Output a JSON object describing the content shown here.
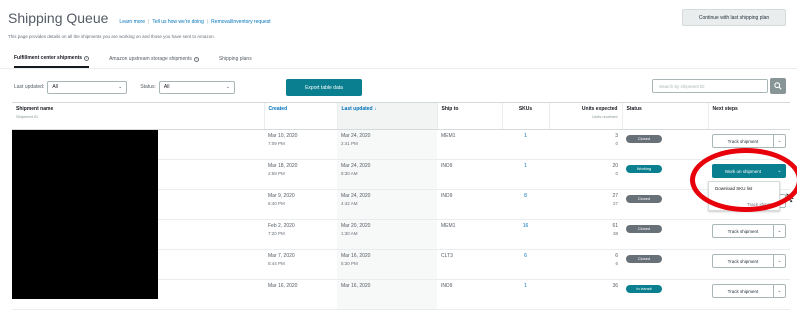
{
  "header": {
    "title": "Shipping Queue",
    "links": [
      "Learn more",
      "Tell us how we're doing",
      "Removal/inventory request"
    ],
    "continue_button": "Continue with last shipping plan"
  },
  "description": "This page provides details on all the shipments you are working on and those you have sent to Amazon.",
  "tabs": [
    "Fulfillment center shipments",
    "Amazon upstream storage shipments",
    "Shipping plans"
  ],
  "filters": {
    "last_updated_label": "Last updated:",
    "last_updated_value": "All",
    "status_label": "Status:",
    "status_value": "All",
    "export_button": "Export table data",
    "search_placeholder": "Search by shipment ID"
  },
  "table": {
    "headers": {
      "name": "Shipment name",
      "name_sub": "Shipment ID",
      "created": "Created",
      "last_updated": "Last updated",
      "ship_to": "Ship to",
      "skus": "SKUs",
      "units": "Units expected",
      "units_sub": "Units received",
      "status": "Status",
      "next": "Next steps"
    },
    "rows": [
      {
        "created_date": "Mar 10, 2020",
        "created_time": "7:09 PM",
        "updated_date": "Mar 24, 2020",
        "updated_time": "2:41 PM",
        "ship_to": "MEM1",
        "skus": "1",
        "units_expected": "3",
        "units_received": "0",
        "status": "Closed",
        "next_step": "Track shipment"
      },
      {
        "created_date": "Mar 18, 2020",
        "created_time": "2:59 PM",
        "updated_date": "Mar 24, 2020",
        "updated_time": "8:30 AM",
        "ship_to": "IND9",
        "skus": "1",
        "units_expected": "20",
        "units_received": "0",
        "status": "Working",
        "next_step": "Work on shipment"
      },
      {
        "created_date": "Mar 9, 2020",
        "created_time": "6:40 PM",
        "updated_date": "Mar 24, 2020",
        "updated_time": "4:42 AM",
        "ship_to": "IND9",
        "skus": "8",
        "units_expected": "27",
        "units_received": "27",
        "status": "Closed",
        "next_step": "Track shipment"
      },
      {
        "created_date": "Feb 2, 2020",
        "created_time": "7:20 PM",
        "updated_date": "Mar 20, 2020",
        "updated_time": "1:30 AM",
        "ship_to": "MEM1",
        "skus": "16",
        "units_expected": "61",
        "units_received": "38",
        "status": "Closed",
        "next_step": "Track shipment"
      },
      {
        "created_date": "Mar 7, 2020",
        "created_time": "5:44 PM",
        "updated_date": "Mar 16, 2020",
        "updated_time": "5:30 PM",
        "ship_to": "CLT3",
        "skus": "6",
        "units_expected": "6",
        "units_received": "6",
        "status": "Closed",
        "next_step": "Track shipment"
      },
      {
        "created_date": "Mar 16, 2020",
        "created_time": "",
        "updated_date": "Mar 16, 2020",
        "updated_time": "",
        "ship_to": "IND9",
        "skus": "1",
        "units_expected": "36",
        "units_received": "",
        "status": "In transit",
        "next_step": "Track shipment"
      }
    ]
  },
  "dropdown_menu": [
    "Download SKU list",
    "Track shipment"
  ],
  "colors": {
    "teal": "#0a7f8f",
    "closed_badge": "#687078",
    "working_badge": "#0a7f8f",
    "in_transit_badge": "#0a7f8f",
    "annotation": "#e8000a"
  }
}
